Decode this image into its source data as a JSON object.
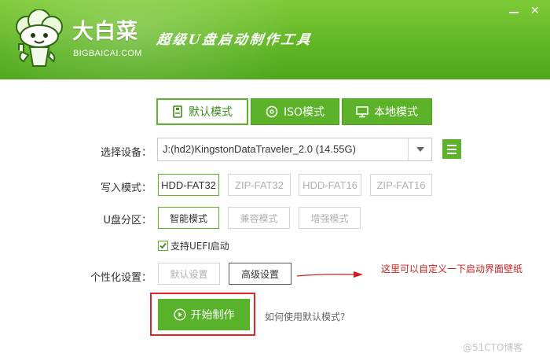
{
  "header": {
    "brand_cn": "大白菜",
    "brand_en": "BIGBAICAI.COM",
    "slogan": "超级U盘启动制作工具",
    "minimize_symbol": "",
    "close_symbol": "✕"
  },
  "tabs": [
    {
      "label": "默认模式",
      "icon": "usb-drive-icon",
      "active": true
    },
    {
      "label": "ISO模式",
      "icon": "disc-icon",
      "active": false
    },
    {
      "label": "本地模式",
      "icon": "monitor-icon",
      "active": false
    }
  ],
  "form": {
    "device_label": "选择设备：",
    "device_value": "J:(hd2)KingstonDataTraveler_2.0 (14.55G)",
    "write_mode_label": "写入模式：",
    "write_modes": [
      "HDD-FAT32",
      "ZIP-FAT32",
      "HDD-FAT16",
      "ZIP-FAT16"
    ],
    "partition_label": "U盘分区：",
    "partitions": [
      "智能模式",
      "兼容模式",
      "增强模式"
    ],
    "uefi_label": "支持UEFI启动",
    "uefi_checked": true,
    "personalize_label": "个性化设置：",
    "personalize_options": [
      "默认设置",
      "高级设置"
    ]
  },
  "annotation": "这里可以自定义一下启动界面壁纸",
  "start_button": "开始制作",
  "help_link": "如何使用默认模式?",
  "watermark": "@51CTO博客",
  "colors": {
    "brand_green": "#5cb32a",
    "annotation_red": "#cc1f1f",
    "highlight_frame": "#e0262a"
  }
}
